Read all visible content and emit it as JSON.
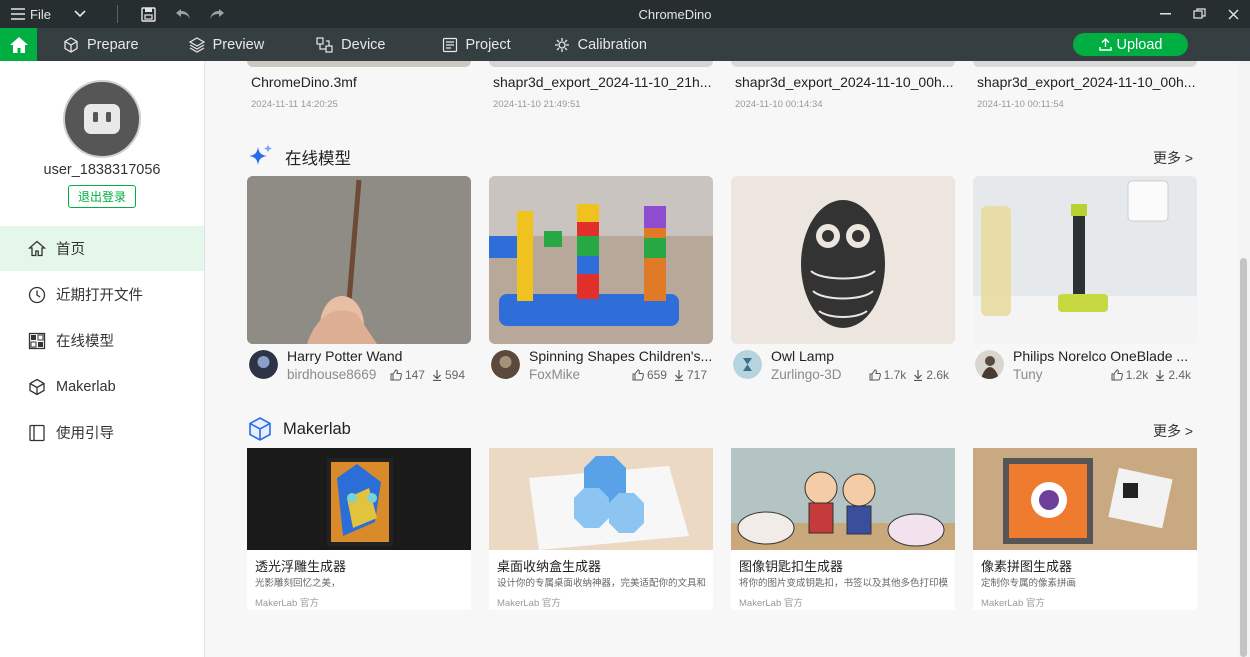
{
  "titlebar": {
    "file_label": "File",
    "app_title": "ChromeDino"
  },
  "nav": {
    "tabs": [
      {
        "label": "Prepare",
        "icon": "cube-icon"
      },
      {
        "label": "Preview",
        "icon": "layers-icon"
      },
      {
        "label": "Device",
        "icon": "device-icon"
      },
      {
        "label": "Project",
        "icon": "project-icon"
      },
      {
        "label": "Calibration",
        "icon": "calibration-icon"
      }
    ],
    "upload_label": "Upload"
  },
  "sidebar": {
    "username": "user_1838317056",
    "logout_label": "退出登录",
    "items": [
      {
        "label": "首页",
        "icon": "home-icon",
        "active": true
      },
      {
        "label": "近期打开文件",
        "icon": "clock-icon",
        "active": false
      },
      {
        "label": "在线模型",
        "icon": "online-models-icon",
        "active": false
      },
      {
        "label": "Makerlab",
        "icon": "makerlab-icon",
        "active": false
      },
      {
        "label": "使用引导",
        "icon": "guide-icon",
        "active": false
      }
    ]
  },
  "recent_files": [
    {
      "name": "ChromeDino.3mf",
      "date": "2024-11-11 14:20:25"
    },
    {
      "name": "shapr3d_export_2024-11-10_21h...",
      "date": "2024-11-10 21:49:51"
    },
    {
      "name": "shapr3d_export_2024-11-10_00h...",
      "date": "2024-11-10 00:14:34"
    },
    {
      "name": "shapr3d_export_2024-11-10_00h...",
      "date": "2024-11-10 00:11:54"
    }
  ],
  "online_models": {
    "heading": "在线模型",
    "more_label": "更多 >",
    "items": [
      {
        "title": "Harry Potter Wand",
        "author": "birdhouse8669",
        "likes": "147",
        "downloads": "594"
      },
      {
        "title": "Spinning Shapes Children's...",
        "author": "FoxMike",
        "likes": "659",
        "downloads": "717"
      },
      {
        "title": "Owl Lamp",
        "author": "Zurlingo-3D",
        "likes": "1.7k",
        "downloads": "2.6k"
      },
      {
        "title": "Philips Norelco OneBlade ...",
        "author": "Tuny",
        "likes": "1.2k",
        "downloads": "2.4k"
      }
    ]
  },
  "makerlab": {
    "heading": "Makerlab",
    "more_label": "更多 >",
    "items": [
      {
        "title": "透光浮雕生成器",
        "desc": "光影雕刻回忆之美，",
        "source": "MakerLab 官方"
      },
      {
        "title": "桌面收纳盒生成器",
        "desc": "设计你的专属桌面收纳神器，完美适配你的文具和...",
        "source": "MakerLab 官方"
      },
      {
        "title": "图像钥匙扣生成器",
        "desc": "将你的图片变成钥匙扣，书签以及其他多色打印模...",
        "source": "MakerLab 官方"
      },
      {
        "title": "像素拼图生成器",
        "desc": "定制你专属的像素拼画",
        "source": "MakerLab 官方"
      }
    ]
  },
  "colors": {
    "brand_green": "#00ae42",
    "titlebar_bg": "#262e30",
    "navbar_bg": "#353e41"
  }
}
